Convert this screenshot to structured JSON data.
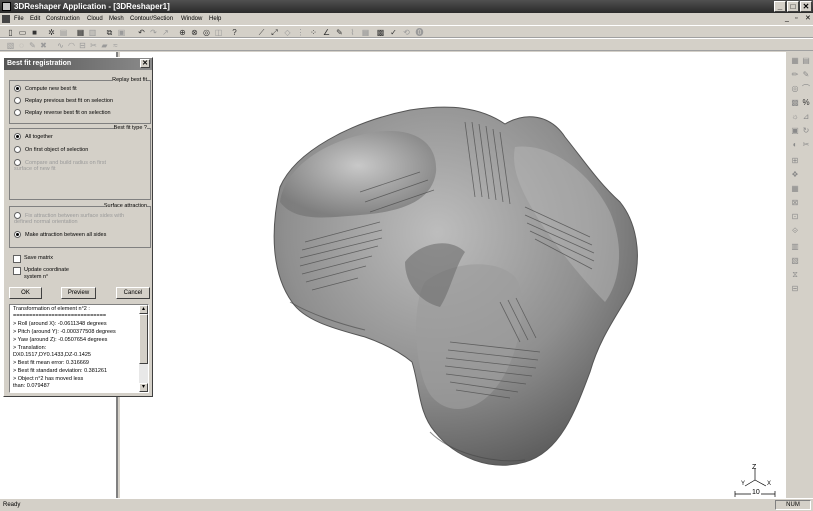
{
  "window": {
    "title": "3DReshaper Application - [3DReshaper1]"
  },
  "menu": [
    "File",
    "Edit",
    "Construction",
    "Cloud",
    "Mesh",
    "Contour/Section",
    "Window",
    "Help"
  ],
  "dialog": {
    "title": "Best fit registration",
    "group1": {
      "title": "Replay best fit",
      "options": [
        "Compute new best fit",
        "Replay previous best fit on selection",
        "Replay reverse best fit on selection"
      ],
      "selected": 0
    },
    "group2": {
      "title": "Best fit type ?",
      "options": [
        "All together",
        "On first object of selection"
      ],
      "selected": 0,
      "disabled_option": "Compare and build radius on first surface of new fit"
    },
    "group3": {
      "title": "Surface attraction",
      "disabled_option": "Fix attraction between surface sides with defined normal orientation",
      "option": "Make attraction between all sides",
      "option_selected": true
    },
    "save_matrix": "Save matrix",
    "update_coord": "Update coordinate system n°",
    "buttons": {
      "ok": "OK",
      "preview": "Preview",
      "cancel": "Cancel"
    },
    "log": [
      "Transformation of element n°2 :",
      "=============================",
      "> Roll (around X): -0.0611348 degrees",
      "> Pitch (around Y): -0.000377508 degrees",
      "> Yaw (around Z): -0.0507654 degrees",
      "> Translation:",
      "  DX0.1517,DY0.1433,DZ-0.1425",
      "> Best fit mean error: 0.316669",
      "> Best fit standard deviation: 0.381261",
      "> Object n°2 has moved less",
      "  than: 0.079487"
    ]
  },
  "axis": {
    "z": "Z",
    "y": "Y",
    "x": "X",
    "scale": "10"
  },
  "status": {
    "text": "Ready",
    "num": "NUM"
  }
}
